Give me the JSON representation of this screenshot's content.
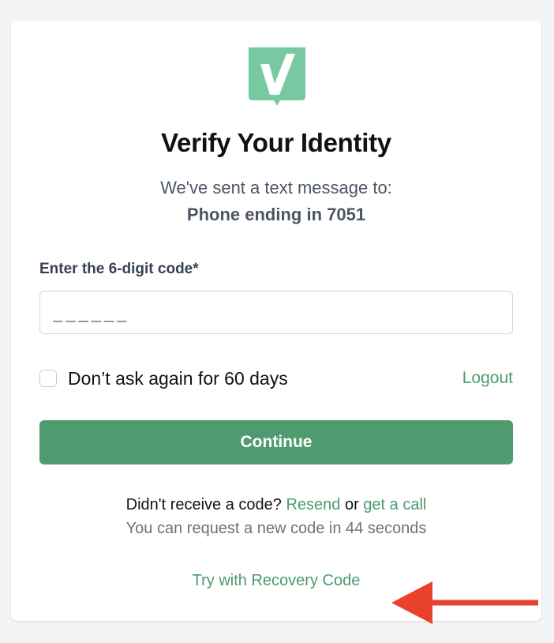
{
  "brand": {
    "logo_icon": "green-checkmark-logo",
    "accent_color": "#4f9b6f",
    "logo_color": "#78c9a1"
  },
  "heading": {
    "title": "Verify Your Identity",
    "subtitle": "We've sent a text message to:",
    "phone": "Phone ending in 7051"
  },
  "form": {
    "code_label": "Enter the 6-digit code*",
    "code_placeholder": "______",
    "code_value": "",
    "remember_label": "Don’t ask again for 60 days",
    "remember_checked": false,
    "logout_label": "Logout",
    "continue_label": "Continue"
  },
  "resend": {
    "prompt": "Didn't receive a code?",
    "resend_label": "Resend",
    "or_text": "or",
    "call_label": "get a call",
    "countdown_text": "You can request a new code in 44 seconds"
  },
  "recovery": {
    "label": "Try with Recovery Code"
  },
  "annotation": {
    "arrow_icon": "red-arrow-left-icon",
    "arrow_color": "#e8412c"
  }
}
